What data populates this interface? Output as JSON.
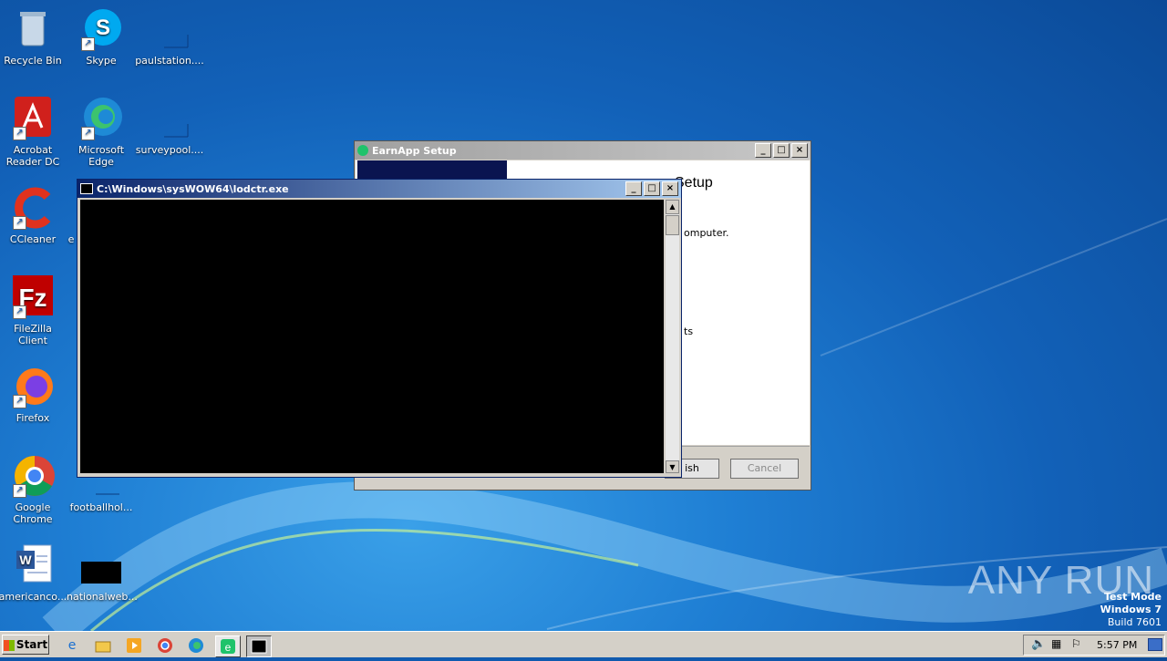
{
  "desktop": {
    "icons": [
      {
        "label": "Recycle Bin",
        "icon": "recycle-bin-icon"
      },
      {
        "label": "Skype",
        "icon": "skype-icon"
      },
      {
        "label": "paulstation....",
        "icon": "file-icon"
      },
      {
        "label": "Acrobat Reader DC",
        "icon": "acrobat-icon"
      },
      {
        "label": "Microsoft Edge",
        "icon": "edge-icon"
      },
      {
        "label": "surveypool....",
        "icon": "file-icon"
      },
      {
        "label": "CCleaner",
        "icon": "ccleaner-icon"
      },
      {
        "label": "e",
        "icon": "file-icon"
      },
      {
        "label": "FileZilla Client",
        "icon": "filezilla-icon"
      },
      {
        "label": "Firefox",
        "icon": "firefox-icon"
      },
      {
        "label": "Google Chrome",
        "icon": "chrome-icon"
      },
      {
        "label": "footballhol...",
        "icon": "file-icon"
      },
      {
        "label": "americanco...",
        "icon": "word-icon"
      },
      {
        "label": "nationalweb...",
        "icon": "file-icon"
      }
    ]
  },
  "earnapp": {
    "title": "EarnApp Setup",
    "heading_fragment": "Setup",
    "text1_fragment": "omputer.",
    "text2_fragment": "ts",
    "finish_fragment": "ish",
    "cancel_label": "Cancel"
  },
  "console": {
    "title": "C:\\Windows\\sysWOW64\\lodctr.exe"
  },
  "watermark": "ANY RUN",
  "testmode": {
    "line1": "Test Mode",
    "line2": "Windows 7",
    "line3": "Build 7601"
  },
  "taskbar": {
    "start_label": "Start",
    "clock": "5:57 PM"
  }
}
